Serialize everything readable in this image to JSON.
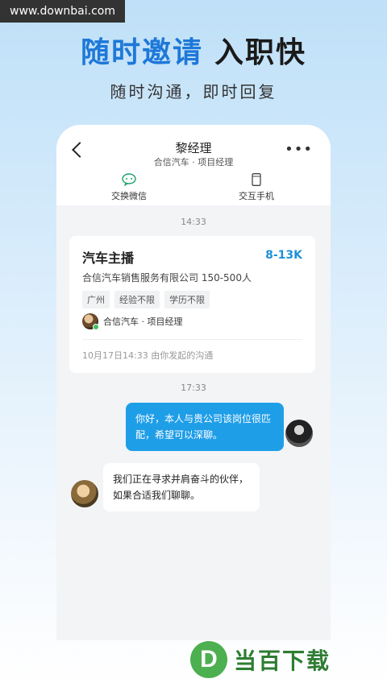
{
  "watermark": {
    "site": "www.downbai.com",
    "brand": "当百下载",
    "logo_letter": "D"
  },
  "hero": {
    "headline_blue": "随时邀请",
    "headline_dark": "入职快",
    "subline": "随时沟通，即时回复"
  },
  "header": {
    "title": "黎经理",
    "subtitle": "合信汽车 · 项目经理",
    "more": "•••"
  },
  "toolbar": {
    "wechat_label": "交换微信",
    "phone_label": "交互手机"
  },
  "chat": {
    "time1": "14:33",
    "job": {
      "title": "汽车主播",
      "salary": "8-13K",
      "company": "合信汽车销售服务有限公司  150-500人",
      "tags": [
        "广州",
        "经验不限",
        "学历不限"
      ],
      "recruiter": "合信汽车 · 项目经理",
      "origin": "10月17日14:33 由你发起的沟通"
    },
    "time2": "17:33",
    "msg_me": "你好，本人与贵公司该岗位很匹配，希望可以深聊。",
    "msg_them": "我们正在寻求并肩奋斗的伙伴，如果合适我们聊聊。"
  },
  "colors": {
    "accent": "#1e78d8",
    "bubble_me": "#1f9ee8",
    "salary": "#1e90d8",
    "brand": "#4caf50"
  }
}
